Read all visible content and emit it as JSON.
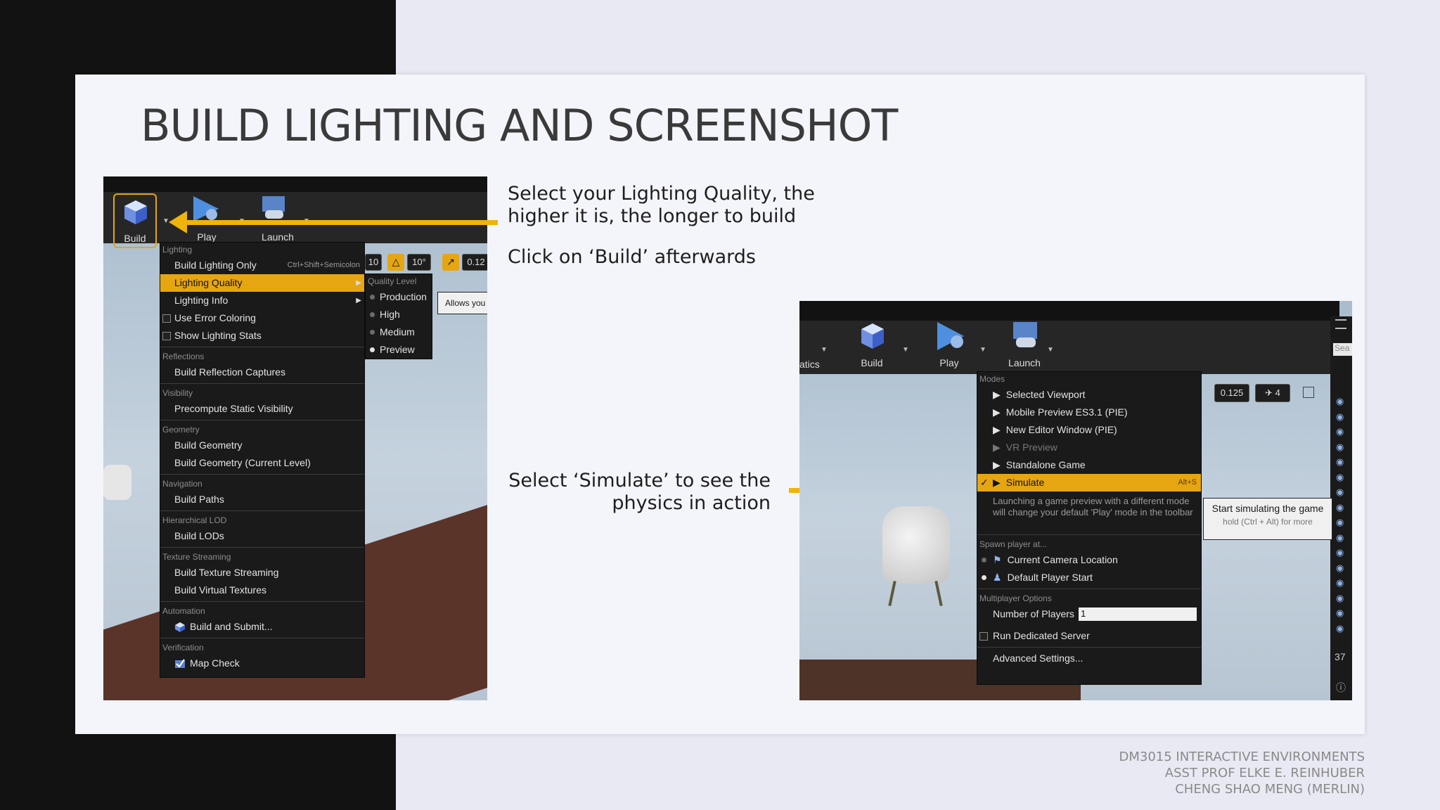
{
  "slide": {
    "title": "BUILD LIGHTING AND SCREENSHOT",
    "instruction_1_line1": "Select your Lighting Quality, the",
    "instruction_1_line2": "higher it is, the longer to build",
    "instruction_2": "Click on ‘Build’ afterwards",
    "instruction_3_line1": "Select ‘Simulate’ to see the",
    "instruction_3_line2": "physics in action",
    "footer_line1": "DM3015 INTERACTIVE ENVIRONMENTS",
    "footer_line2": "ASST PROF ELKE E. REINHUBER",
    "footer_line3": "CHENG SHAO MENG (MERLIN)"
  },
  "left_toolbar": {
    "build": "Build",
    "play": "Play",
    "launch": "Launch"
  },
  "build_menu": {
    "sections": {
      "lighting": "Lighting",
      "reflections": "Reflections",
      "visibility": "Visibility",
      "geometry": "Geometry",
      "navigation": "Navigation",
      "hlod": "Hierarchical LOD",
      "texture_streaming": "Texture Streaming",
      "automation": "Automation",
      "verification": "Verification"
    },
    "items": {
      "build_lighting_only": "Build Lighting Only",
      "build_lighting_only_shortcut": "Ctrl+Shift+Semicolon",
      "lighting_quality": "Lighting Quality",
      "lighting_info": "Lighting Info",
      "use_error_coloring": "Use Error Coloring",
      "show_lighting_stats": "Show Lighting Stats",
      "build_reflection_captures": "Build Reflection Captures",
      "precompute_static_visibility": "Precompute Static Visibility",
      "build_geometry": "Build Geometry",
      "build_geometry_current": "Build Geometry (Current Level)",
      "build_paths": "Build Paths",
      "build_lods": "Build LODs",
      "build_texture_streaming": "Build Texture Streaming",
      "build_virtual_textures": "Build Virtual Textures",
      "build_and_submit": "Build and Submit...",
      "map_check": "Map Check"
    }
  },
  "quality_submenu": {
    "header": "Quality Level",
    "options": [
      "Production",
      "High",
      "Medium",
      "Preview"
    ],
    "selected": "Preview"
  },
  "left_viewport": {
    "field_a": "10",
    "field_b": "10°",
    "field_c": "0.12",
    "tooltip": "Allows you"
  },
  "right_toolbar": {
    "statics": "atics",
    "build": "Build",
    "play": "Play",
    "launch": "Launch",
    "search": "Sea"
  },
  "play_menu": {
    "modes_header": "Modes",
    "modes": [
      "Selected Viewport",
      "Mobile Preview ES3.1 (PIE)",
      "New Editor Window (PIE)",
      "VR Preview",
      "Standalone Game"
    ],
    "simulate": "Simulate",
    "simulate_shortcut": "Alt+S",
    "description": "Launching a game preview with a different mode will change your default 'Play' mode in the toolbar",
    "spawn_header": "Spawn player at...",
    "spawn_current": "Current Camera Location",
    "spawn_default": "Default Player Start",
    "multiplayer_header": "Multiplayer Options",
    "num_players_label": "Number of Players",
    "num_players_value": "1",
    "dedicated_server": "Run Dedicated Server",
    "advanced": "Advanced Settings..."
  },
  "right_viewport": {
    "field_a": "0.125",
    "field_b": "4",
    "side_number": "37"
  },
  "simulate_tooltip": {
    "line1": "Start simulating the game",
    "line2": "hold (Ctrl + Alt) for more"
  },
  "colors": {
    "accent": "#e6a611",
    "arrow": "#f0b30b",
    "menu_bg": "#1a1a1a"
  }
}
